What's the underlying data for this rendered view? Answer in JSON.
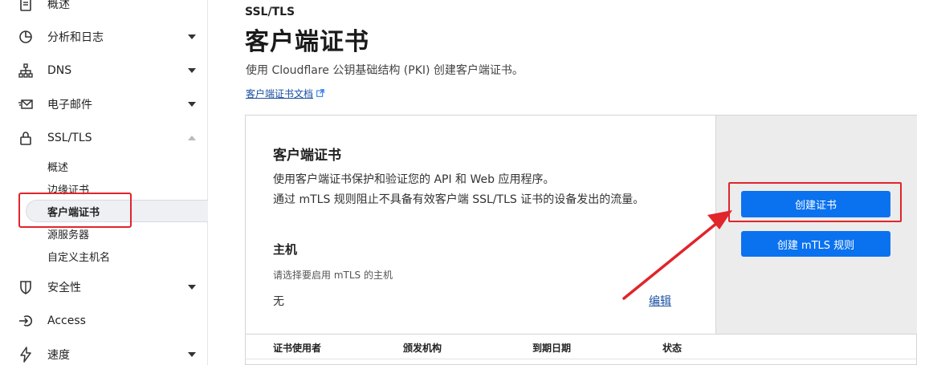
{
  "sidebar": {
    "items": [
      {
        "label": "概述",
        "icon": "document-icon"
      },
      {
        "label": "分析和日志",
        "icon": "pie-chart-icon",
        "chevron": "down"
      },
      {
        "label": "DNS",
        "icon": "network-icon",
        "chevron": "down"
      },
      {
        "label": "电子邮件",
        "icon": "email-icon",
        "chevron": "down"
      },
      {
        "label": "SSL/TLS",
        "icon": "lock-icon",
        "chevron": "up"
      },
      {
        "label": "安全性",
        "icon": "shield-icon",
        "chevron": "down"
      },
      {
        "label": "Access",
        "icon": "login-icon"
      },
      {
        "label": "速度",
        "icon": "lightning-icon",
        "chevron": "down"
      }
    ],
    "ssl_subitems": [
      {
        "label": "概述"
      },
      {
        "label": "边缘证书"
      },
      {
        "label": "客户端证书",
        "active": true
      },
      {
        "label": "源服务器"
      },
      {
        "label": "自定义主机名"
      }
    ]
  },
  "main": {
    "breadcrumb": "SSL/TLS",
    "title": "客户端证书",
    "description": "使用 Cloudflare 公钥基础结构 (PKI) 创建客户端证书。",
    "doc_link": "客户端证书文档",
    "card": {
      "title": "客户端证书",
      "desc_line1": "使用客户端证书保护和验证您的 API 和 Web 应用程序。",
      "desc_line2": "通过 mTLS 规则阻止不具备有效客户端 SSL/TLS 证书的设备发出的流量。",
      "host_title": "主机",
      "host_hint": "请选择要启用 mTLS 的主机",
      "host_value": "无",
      "edit_label": "编辑",
      "create_cert_button": "创建证书",
      "create_rule_button": "创建 mTLS 规则",
      "table_headers": [
        "证书使用者",
        "颁发机构",
        "到期日期",
        "状态"
      ]
    }
  },
  "colors": {
    "accent": "#0a72ef",
    "link": "#1a4fa0",
    "annotation": "#e0252b"
  }
}
